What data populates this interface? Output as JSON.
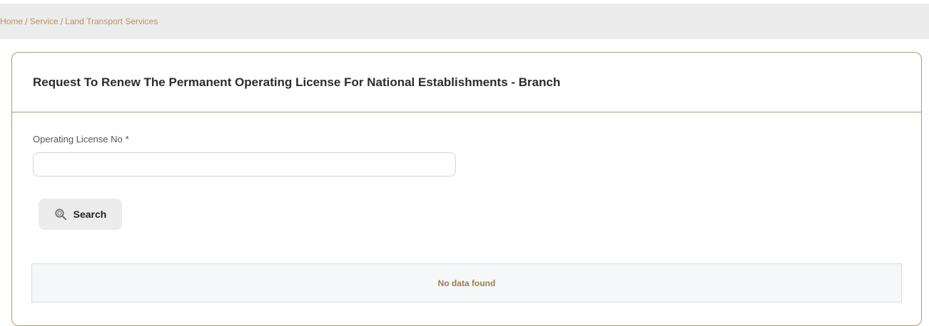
{
  "breadcrumb": {
    "items": [
      "Home",
      "Service",
      "Land Transport Services"
    ],
    "separator": "/"
  },
  "card": {
    "title": "Request To Renew The Permanent Operating License For National Establishments - Branch"
  },
  "form": {
    "license_label": "Operating License No",
    "required_marker": "*",
    "license_value": "",
    "license_placeholder": ""
  },
  "actions": {
    "search_label": "Search",
    "search_icon": "search-icon"
  },
  "results": {
    "empty_message": "No data found"
  },
  "colors": {
    "accent": "#b1956a",
    "border": "#b39872",
    "required": "#b1262b",
    "breadcrumb_bg": "#ececec"
  }
}
